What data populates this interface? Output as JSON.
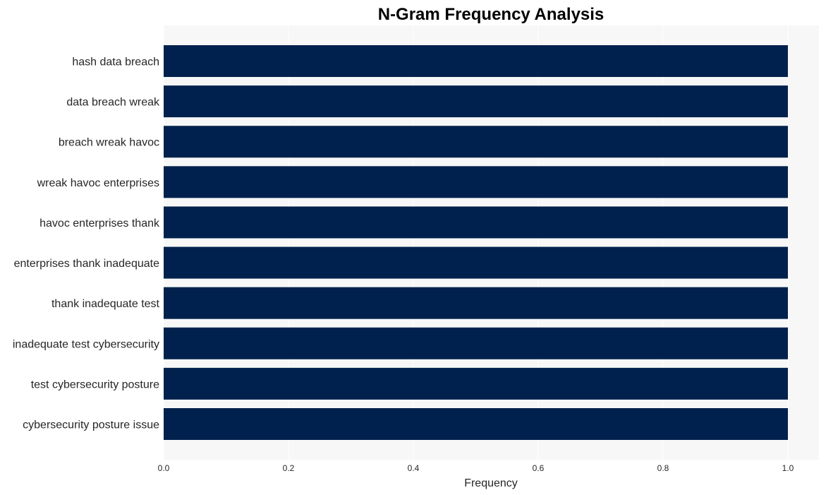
{
  "chart_data": {
    "type": "bar",
    "orientation": "horizontal",
    "title": "N-Gram Frequency Analysis",
    "xlabel": "Frequency",
    "ylabel": "",
    "xlim": [
      0,
      1.05
    ],
    "xticks": [
      0.0,
      0.2,
      0.4,
      0.6,
      0.8,
      1.0
    ],
    "xtick_labels": [
      "0.0",
      "0.2",
      "0.4",
      "0.6",
      "0.8",
      "1.0"
    ],
    "grid": true,
    "bar_color": "#00214d",
    "background_color": "#f7f7f7",
    "grid_color": "#ffffff",
    "categories": [
      "hash data breach",
      "data breach wreak",
      "breach wreak havoc",
      "wreak havoc enterprises",
      "havoc enterprises thank",
      "enterprises thank inadequate",
      "thank inadequate test",
      "inadequate test cybersecurity",
      "test cybersecurity posture",
      "cybersecurity posture issue"
    ],
    "values": [
      1,
      1,
      1,
      1,
      1,
      1,
      1,
      1,
      1,
      1
    ]
  }
}
